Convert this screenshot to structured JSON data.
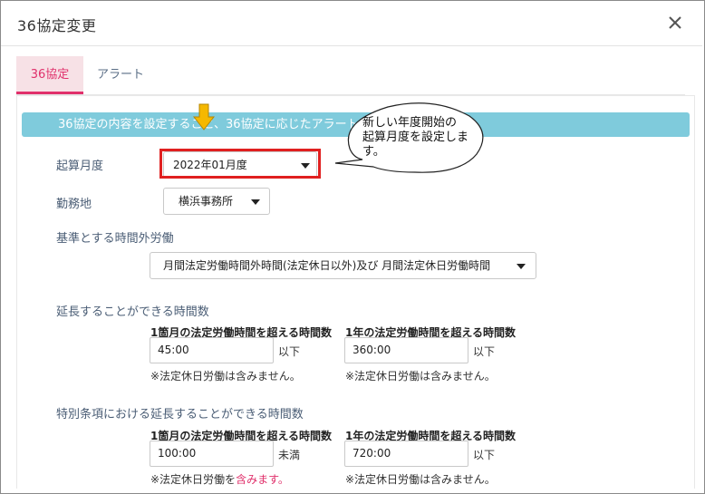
{
  "dialog": {
    "title": "36協定変更"
  },
  "tabs": [
    {
      "label": "36協定"
    },
    {
      "label": "アラート"
    }
  ],
  "banner": {
    "text": "36協定の内容を設定すること、36協定に応じたアラート"
  },
  "callout": {
    "line1": "新しい年度開始の",
    "line2": "起算月度を設定しま",
    "line3": "す。"
  },
  "form": {
    "start_month_label": "起算月度",
    "start_month_value": "2022年01月度",
    "workplace_label": "勤務地",
    "workplace_value": "横浜事務所",
    "base_overtime_label": "基準とする時間外労働",
    "base_overtime_value": "月間法定労働時間外時間(法定休日以外)及び 月間法定休日労働時間"
  },
  "extension": {
    "label": "延長することができる時間数",
    "monthly_header": "1箇月の法定労働時間を超える時間数",
    "monthly_value": "45:00",
    "monthly_suffix": "以下",
    "monthly_note": "※法定休日労働は含みません。",
    "yearly_header": "1年の法定労働時間を超える時間数",
    "yearly_value": "360:00",
    "yearly_suffix": "以下",
    "yearly_note": "※法定休日労働は含みません。"
  },
  "special": {
    "label": "特別条項における延長することができる時間数",
    "monthly_header": "1箇月の法定労働時間を超える時間数",
    "monthly_value": "100:00",
    "monthly_suffix": "未満",
    "monthly_note_prefix": "※法定休日労働を",
    "monthly_note_highlight": "含みます。",
    "yearly_header": "1年の法定労働時間を超える時間数",
    "yearly_value": "720:00",
    "yearly_suffix": "以下",
    "yearly_note": "※法定休日労働は含みません。"
  },
  "colors": {
    "accent": "#e0306b",
    "banner": "#7fcbdc",
    "highlight_border": "#e02020",
    "arrow": "#f5b800"
  }
}
